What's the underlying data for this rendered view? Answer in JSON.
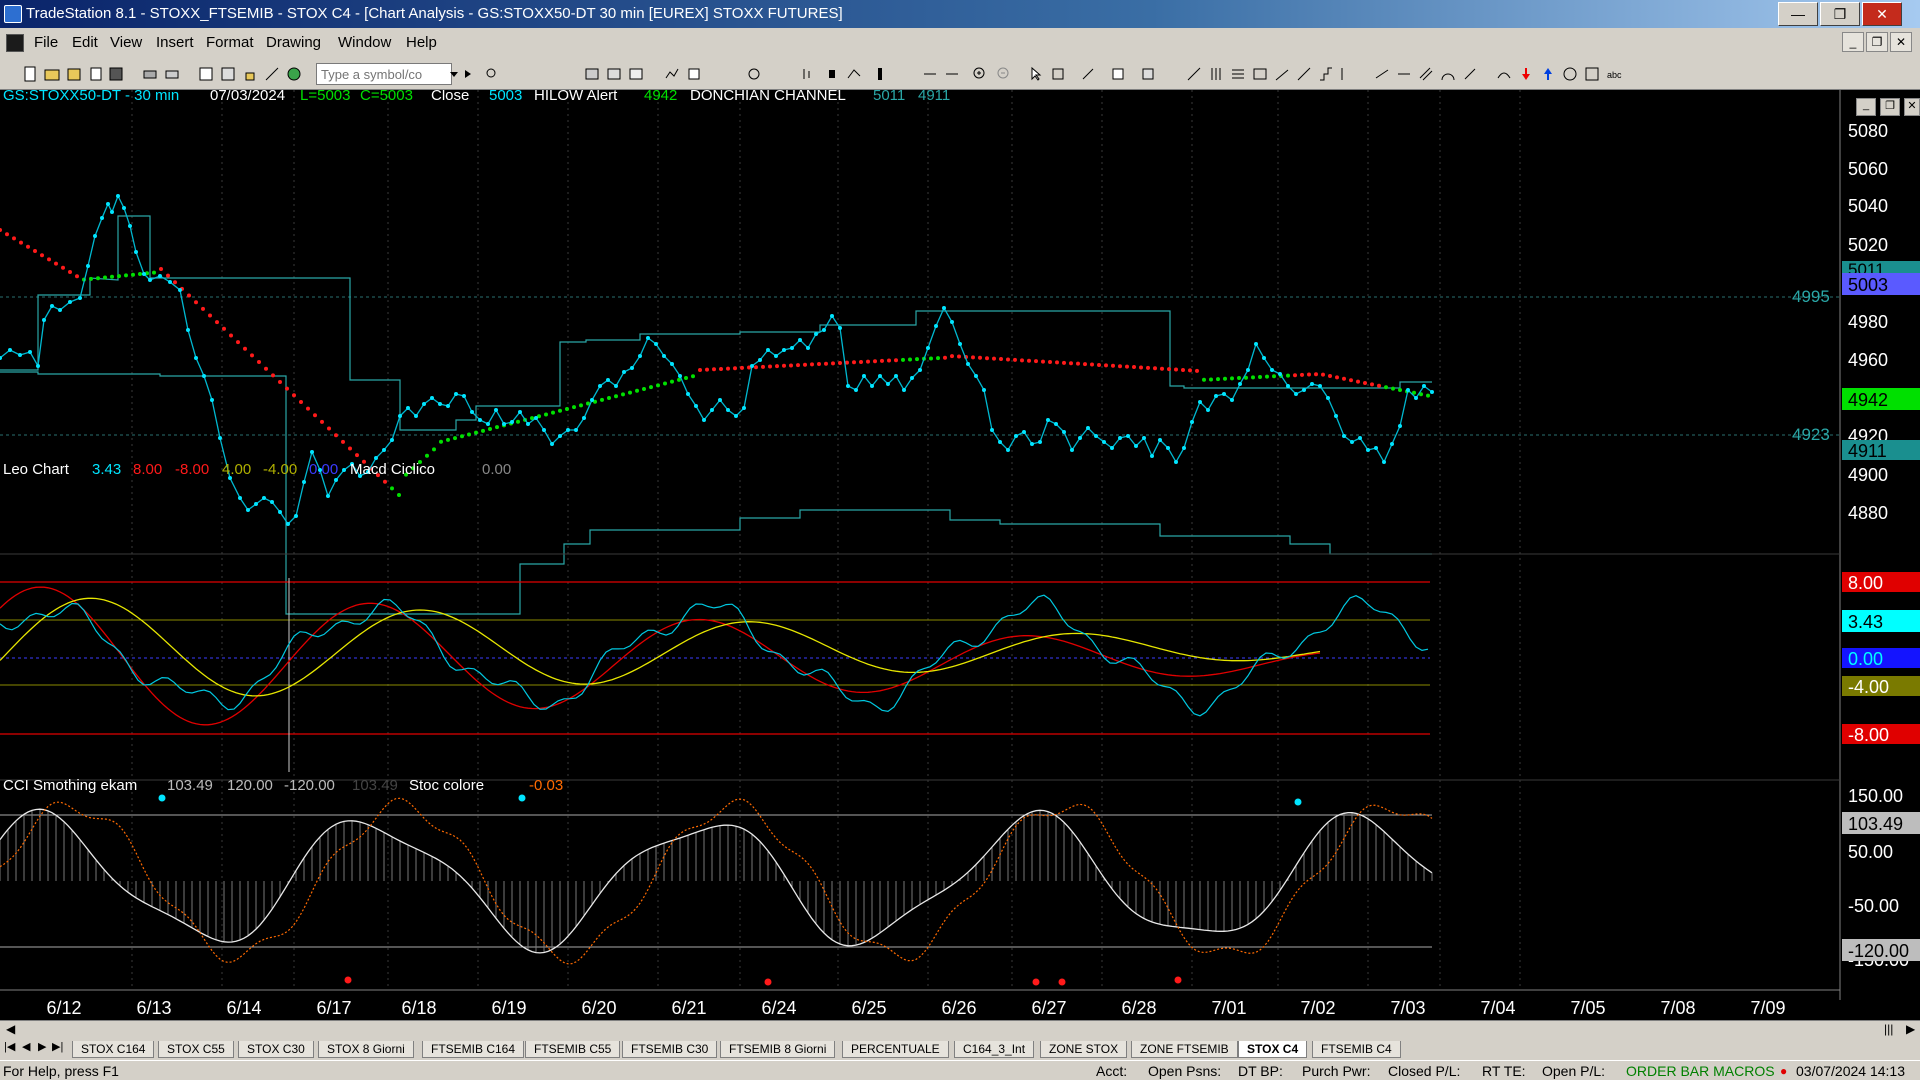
{
  "window": {
    "title": "TradeStation 8.1 - STOXX_FTSEMIB - STOX  C4 - [Chart Analysis - GS:STOXX50-DT  30 min  [EUREX] STOXX FUTURES]"
  },
  "menu": {
    "items": [
      "File",
      "Edit",
      "View",
      "Insert",
      "Format",
      "Drawing",
      "Window",
      "Help"
    ]
  },
  "toolbar": {
    "symbol_placeholder": "Type a symbol/co"
  },
  "price_panel": {
    "symbol": "GS:STOXX50-DT - 30 min",
    "date": "07/03/2024",
    "low": "L=5003",
    "close": "C=5003",
    "close_label": "Close",
    "close_value": "5003",
    "hilow_value": "HILOW Alert",
    "hilow_num": "4942",
    "donchian_label": "DONCHIAN CHANNEL",
    "donchian_upper": "5011",
    "donchian_lower": "4911",
    "y_ticks": [
      "5080",
      "5060",
      "5040",
      "5020",
      "4980",
      "4960",
      "4920",
      "4900",
      "4880"
    ],
    "tags": {
      "upper": "5011",
      "close": "5003",
      "green": "4942",
      "lower": "4911",
      "line_4995": "4995",
      "line_4923": "4923"
    }
  },
  "leo_panel": {
    "title": "Leo Chart",
    "values": [
      "3.43",
      "8.00",
      "-8.00",
      "4.00",
      "-4.00",
      "0.00"
    ],
    "macd_label": "Macd Ciclico",
    "macd_value": "0.00",
    "tags": [
      "8.00",
      "3.43",
      "0.00",
      "-4.00",
      "-8.00"
    ]
  },
  "cci_panel": {
    "title": "CCI Smothing ekam",
    "values": [
      "103.49",
      "120.00",
      "-120.00",
      "103.49"
    ],
    "stoc_label": "Stoc colore",
    "stoc_value": "-0.03",
    "y_ticks": [
      "150.00",
      "50.00",
      "-50.00",
      "-150.00"
    ],
    "tags": [
      "103.49",
      "-120.00"
    ]
  },
  "x_axis": {
    "dates": [
      "6/12",
      "6/13",
      "6/14",
      "6/17",
      "6/18",
      "6/19",
      "6/20",
      "6/21",
      "6/24",
      "6/25",
      "6/26",
      "6/27",
      "6/28",
      "7/01",
      "7/02",
      "7/03",
      "7/04",
      "7/05",
      "7/08",
      "7/09"
    ]
  },
  "sheet_tabs": [
    "STOX C164",
    "STOX C55",
    "STOX  C30",
    "STOX  8 Giorni",
    "FTSEMIB C164",
    "FTSEMIB C55",
    "FTSEMIB C30",
    "FTSEMIB  8 Giorni",
    "PERCENTUALE",
    "C164_3_Int",
    "ZONE STOX",
    "ZONE FTSEMIB",
    "STOX  C4",
    "FTSEMIB C4"
  ],
  "active_tab_index": 12,
  "status": {
    "help": "For Help, press F1",
    "acct": "Acct:",
    "open_psns": "Open Psns:",
    "dt_bp": "DT BP:",
    "purch_pwr": "Purch Pwr:",
    "closed_pl": "Closed P/L:",
    "rt_te": "RT TE:",
    "open_pl": "Open P/L:",
    "macros": "ORDER BAR  MACROS",
    "datetime": "03/07/2024 14:13"
  },
  "colors": {
    "cyan": "#00e5ff",
    "red": "#ff1a1a",
    "green": "#00e000",
    "teal": "#2aa7a7",
    "yellow": "#e6e600",
    "blue": "#3b3bff",
    "axis_bg": "#000000",
    "macros_green": "#008000"
  }
}
